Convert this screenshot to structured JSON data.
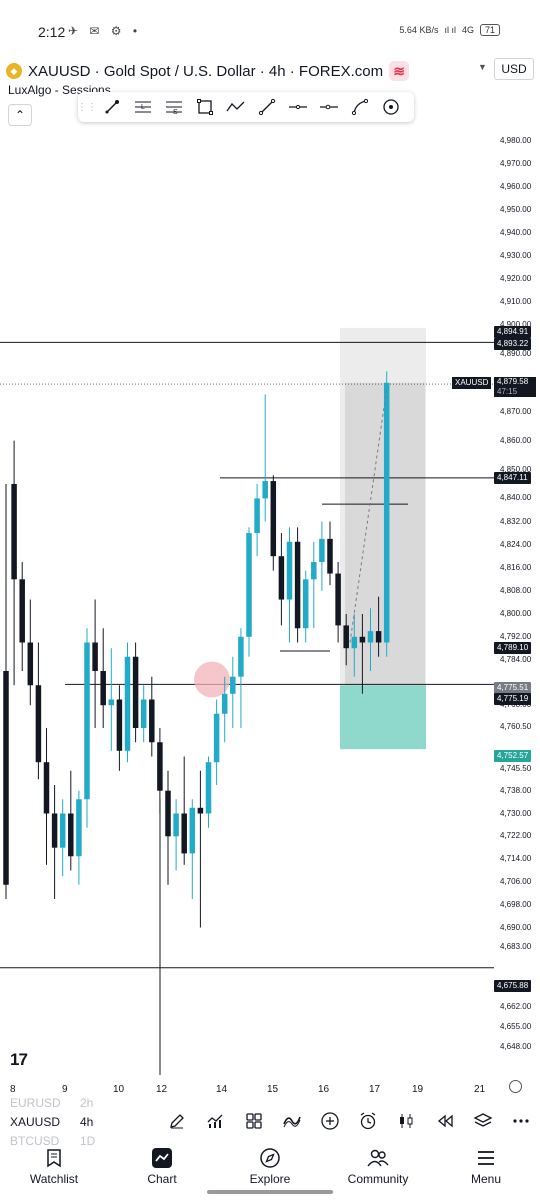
{
  "status_bar": {
    "time": "2:12",
    "icons": "✈ ✉ ⚙ •",
    "net_speed": "5.64 KB/s",
    "signal": "ıl ıl",
    "network": "4G",
    "battery": "71"
  },
  "header": {
    "symbol_line": "XAUUSD · Gold Spot / U.S. Dollar · 4h · FOREX.com",
    "coin_glyph": "◆",
    "waves_glyph": "≋",
    "dropdown_glyph": "▼",
    "currency": "USD",
    "indicator": "LuxAlgo - Sessions",
    "collapse_glyph": "⌃"
  },
  "drawing_toolbar": {
    "tools": [
      "brush-icon",
      "long-position-icon",
      "short-position-icon",
      "rectangle-icon",
      "path-icon",
      "trend-line-icon",
      "horizontal-line-icon",
      "horizontal-ray-icon",
      "curve-icon",
      "magnet-icon"
    ]
  },
  "price_scale": {
    "ticks": [
      "4,980.00",
      "4,970.00",
      "4,960.00",
      "4,950.00",
      "4,940.00",
      "4,930.00",
      "4,920.00",
      "4,910.00",
      "4,900.00",
      "4,890.00",
      "4,870.00",
      "4,860.00",
      "4,850.00",
      "4,840.00",
      "4,832.00",
      "4,824.00",
      "4,816.00",
      "4,808.00",
      "4,800.00",
      "4,792.00",
      "4,784.00",
      "4,768.00",
      "4,760.50",
      "4,745.50",
      "4,738.00",
      "4,730.00",
      "4,722.00",
      "4,714.00",
      "4,706.00",
      "4,698.00",
      "4,690.00",
      "4,683.00",
      "4,669.00",
      "4,662.00",
      "4,655.00",
      "4,648.00"
    ],
    "badges": {
      "line_upper_a": "4,894.91",
      "line_upper_b": "4,893.22",
      "current_symbol": "XAUUSD",
      "current_price": "4,879.58",
      "countdown": "47:15",
      "resistance": "4,847.11",
      "crosshair": "4,789.10",
      "support_a": "4,775.51",
      "support_b": "4,775.19",
      "target": "4,752.57",
      "lower_line": "4,675.88"
    }
  },
  "time_axis": {
    "dates": [
      "8",
      "9",
      "10",
      "12",
      "14",
      "15",
      "16",
      "17",
      "19",
      "21"
    ]
  },
  "chart_data": {
    "type": "candlestick",
    "price_range": [
      4648,
      4986
    ],
    "x_labels": [
      "8",
      "9",
      "10",
      "12",
      "14",
      "15",
      "16",
      "17",
      "19",
      "21"
    ],
    "candles": [
      {
        "o": 4780,
        "h": 4845,
        "l": 4700,
        "c": 4705
      },
      {
        "o": 4845,
        "h": 4860,
        "l": 4775,
        "c": 4812
      },
      {
        "o": 4812,
        "h": 4818,
        "l": 4780,
        "c": 4790
      },
      {
        "o": 4790,
        "h": 4805,
        "l": 4768,
        "c": 4775
      },
      {
        "o": 4775,
        "h": 4790,
        "l": 4742,
        "c": 4748
      },
      {
        "o": 4748,
        "h": 4760,
        "l": 4712,
        "c": 4730
      },
      {
        "o": 4730,
        "h": 4740,
        "l": 4700,
        "c": 4718
      },
      {
        "o": 4718,
        "h": 4735,
        "l": 4708,
        "c": 4730
      },
      {
        "o": 4730,
        "h": 4745,
        "l": 4710,
        "c": 4715
      },
      {
        "o": 4715,
        "h": 4738,
        "l": 4705,
        "c": 4735
      },
      {
        "o": 4735,
        "h": 4795,
        "l": 4725,
        "c": 4790
      },
      {
        "o": 4790,
        "h": 4805,
        "l": 4760,
        "c": 4780
      },
      {
        "o": 4780,
        "h": 4795,
        "l": 4760,
        "c": 4768
      },
      {
        "o": 4768,
        "h": 4788,
        "l": 4752,
        "c": 4770
      },
      {
        "o": 4770,
        "h": 4775,
        "l": 4745,
        "c": 4752
      },
      {
        "o": 4752,
        "h": 4790,
        "l": 4748,
        "c": 4785
      },
      {
        "o": 4785,
        "h": 4790,
        "l": 4755,
        "c": 4760
      },
      {
        "o": 4760,
        "h": 4775,
        "l": 4755,
        "c": 4770
      },
      {
        "o": 4770,
        "h": 4778,
        "l": 4750,
        "c": 4755
      },
      {
        "o": 4755,
        "h": 4760,
        "l": 4730,
        "c": 4738
      },
      {
        "o": 4738,
        "h": 4745,
        "l": 4705,
        "c": 4722
      },
      {
        "o": 4722,
        "h": 4735,
        "l": 4710,
        "c": 4730
      },
      {
        "o": 4730,
        "h": 4750,
        "l": 4712,
        "c": 4716
      },
      {
        "o": 4716,
        "h": 4735,
        "l": 4700,
        "c": 4732
      },
      {
        "o": 4732,
        "h": 4745,
        "l": 4690,
        "c": 4730
      },
      {
        "o": 4730,
        "h": 4750,
        "l": 4725,
        "c": 4748
      },
      {
        "o": 4748,
        "h": 4770,
        "l": 4740,
        "c": 4765
      },
      {
        "o": 4765,
        "h": 4778,
        "l": 4755,
        "c": 4772
      },
      {
        "o": 4772,
        "h": 4785,
        "l": 4760,
        "c": 4778
      },
      {
        "o": 4778,
        "h": 4795,
        "l": 4760,
        "c": 4792
      },
      {
        "o": 4792,
        "h": 4830,
        "l": 4785,
        "c": 4828
      },
      {
        "o": 4828,
        "h": 4845,
        "l": 4820,
        "c": 4840
      },
      {
        "o": 4840,
        "h": 4876,
        "l": 4832,
        "c": 4846
      },
      {
        "o": 4846,
        "h": 4848,
        "l": 4815,
        "c": 4820
      },
      {
        "o": 4820,
        "h": 4828,
        "l": 4796,
        "c": 4805
      },
      {
        "o": 4805,
        "h": 4830,
        "l": 4790,
        "c": 4825
      },
      {
        "o": 4825,
        "h": 4830,
        "l": 4790,
        "c": 4795
      },
      {
        "o": 4795,
        "h": 4815,
        "l": 4790,
        "c": 4812
      },
      {
        "o": 4812,
        "h": 4825,
        "l": 4795,
        "c": 4818
      },
      {
        "o": 4818,
        "h": 4832,
        "l": 4808,
        "c": 4826
      },
      {
        "o": 4826,
        "h": 4832,
        "l": 4810,
        "c": 4814
      },
      {
        "o": 4814,
        "h": 4818,
        "l": 4790,
        "c": 4796
      },
      {
        "o": 4796,
        "h": 4800,
        "l": 4782,
        "c": 4788
      },
      {
        "o": 4788,
        "h": 4800,
        "l": 4778,
        "c": 4792
      },
      {
        "o": 4792,
        "h": 4800,
        "l": 4772,
        "c": 4790
      },
      {
        "o": 4790,
        "h": 4802,
        "l": 4780,
        "c": 4794
      },
      {
        "o": 4794,
        "h": 4806,
        "l": 4785,
        "c": 4790
      },
      {
        "o": 4790,
        "h": 4884,
        "l": 4785,
        "c": 4880
      }
    ]
  },
  "watchlist_rows": [
    {
      "symbol": "EURUSD",
      "tf": "2h"
    },
    {
      "symbol": "XAUUSD",
      "tf": "4h"
    },
    {
      "symbol": "BTCUSD",
      "tf": "1D"
    }
  ],
  "bottom_toolbar": {
    "tools": [
      "pencil-icon",
      "indicators-icon",
      "layout-grid-icon",
      "patterns-icon",
      "plus-circle-icon",
      "alarm-icon",
      "candles-icon",
      "replay-icon",
      "layers-icon",
      "more-icon"
    ]
  },
  "bottom_nav": {
    "items": [
      {
        "label": "Watchlist",
        "icon": "watchlist-icon"
      },
      {
        "label": "Chart",
        "icon": "chart-icon"
      },
      {
        "label": "Explore",
        "icon": "compass-icon"
      },
      {
        "label": "Community",
        "icon": "community-icon"
      },
      {
        "label": "Menu",
        "icon": "menu-icon"
      }
    ]
  },
  "colors": {
    "bull": "#22abc9",
    "bear": "#131722",
    "target_zone": "#8fd9cc",
    "box_grey": "#d9d9d9",
    "marker_circle": "#f2b3b8"
  }
}
